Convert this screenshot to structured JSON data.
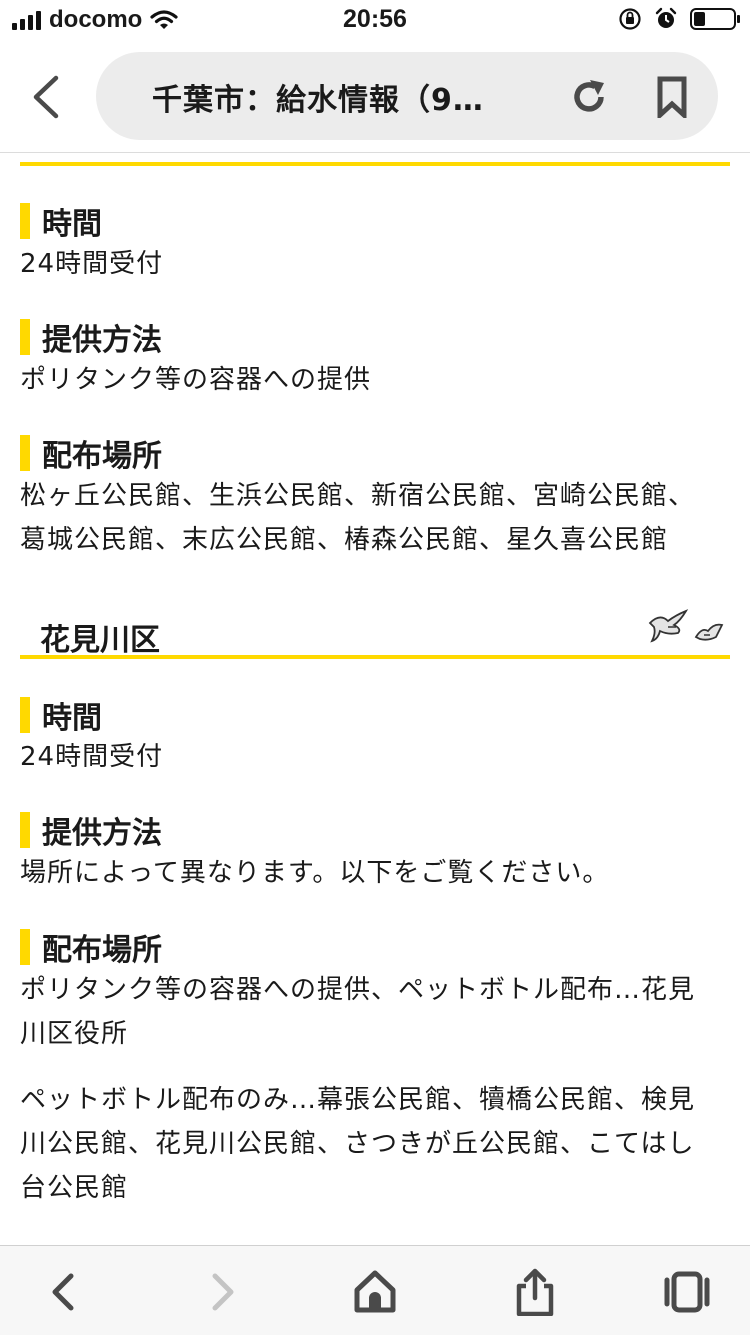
{
  "status_bar": {
    "carrier": "docomo",
    "time": "20:56",
    "battery_level": 0.3
  },
  "address_bar": {
    "title": "千葉市：給水情報（9…",
    "icons": [
      "back-icon",
      "reload-icon",
      "bookmark-icon"
    ]
  },
  "section_chuo": {
    "time_heading": "時間",
    "time_value": "24時間受付",
    "method_heading": "提供方法",
    "method_value": "ポリタンク等の容器への提供",
    "places_heading": "配布場所",
    "places_line1": "松ヶ丘公民館、生浜公民館、新宿公民館、宮崎公民館、",
    "places_line2": "葛城公民館、末広公民館、椿森公民館、星久喜公民館"
  },
  "section_hanamigawa": {
    "title": "花見川区",
    "time_heading": "時間",
    "time_value": "24時間受付",
    "method_heading": "提供方法",
    "method_value": "場所によって異なります。以下をご覧ください。",
    "places_heading": "配布場所",
    "places_p1_line1": "ポリタンク等の容器への提供、ペットボトル配布…花見",
    "places_p1_line2": "川区役所",
    "places_p2_line1": "ペットボトル配布のみ…幕張公民館、犢橋公民館、検見",
    "places_p2_line2": "川公民館、花見川公民館、さつきが丘公民館、こてはし",
    "places_p2_line3": "台公民館"
  },
  "toolbar": {
    "icons": [
      "back-arrow-icon",
      "forward-arrow-icon",
      "home-icon",
      "share-icon",
      "tabs-icon"
    ]
  },
  "colors": {
    "accent_yellow": "#ffd900",
    "pill_gray": "#ececec",
    "icon_gray": "#4a4a4a",
    "disabled_gray": "#c4c4c4"
  }
}
